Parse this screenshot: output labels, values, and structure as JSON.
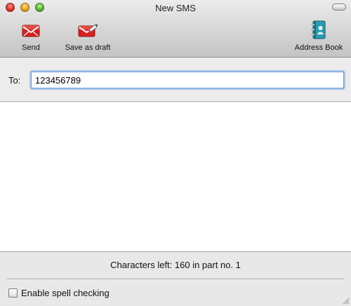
{
  "window": {
    "title": "New SMS"
  },
  "toolbar": {
    "send_label": "Send",
    "draft_label": "Save as draft",
    "address_book_label": "Address Book"
  },
  "recipient": {
    "label": "To:",
    "value": "123456789"
  },
  "message": {
    "value": ""
  },
  "status": {
    "chars_text": "Characters left: 160 in part no. 1",
    "spell_label": "Enable spell checking",
    "spell_checked": false
  },
  "icons": {
    "send": "send-message-icon",
    "draft": "save-draft-icon",
    "address_book": "address-book-icon"
  },
  "colors": {
    "icon_red": "#d8201e",
    "focus_ring": "#a9c7ec",
    "address_book_teal": "#2a9db5"
  }
}
